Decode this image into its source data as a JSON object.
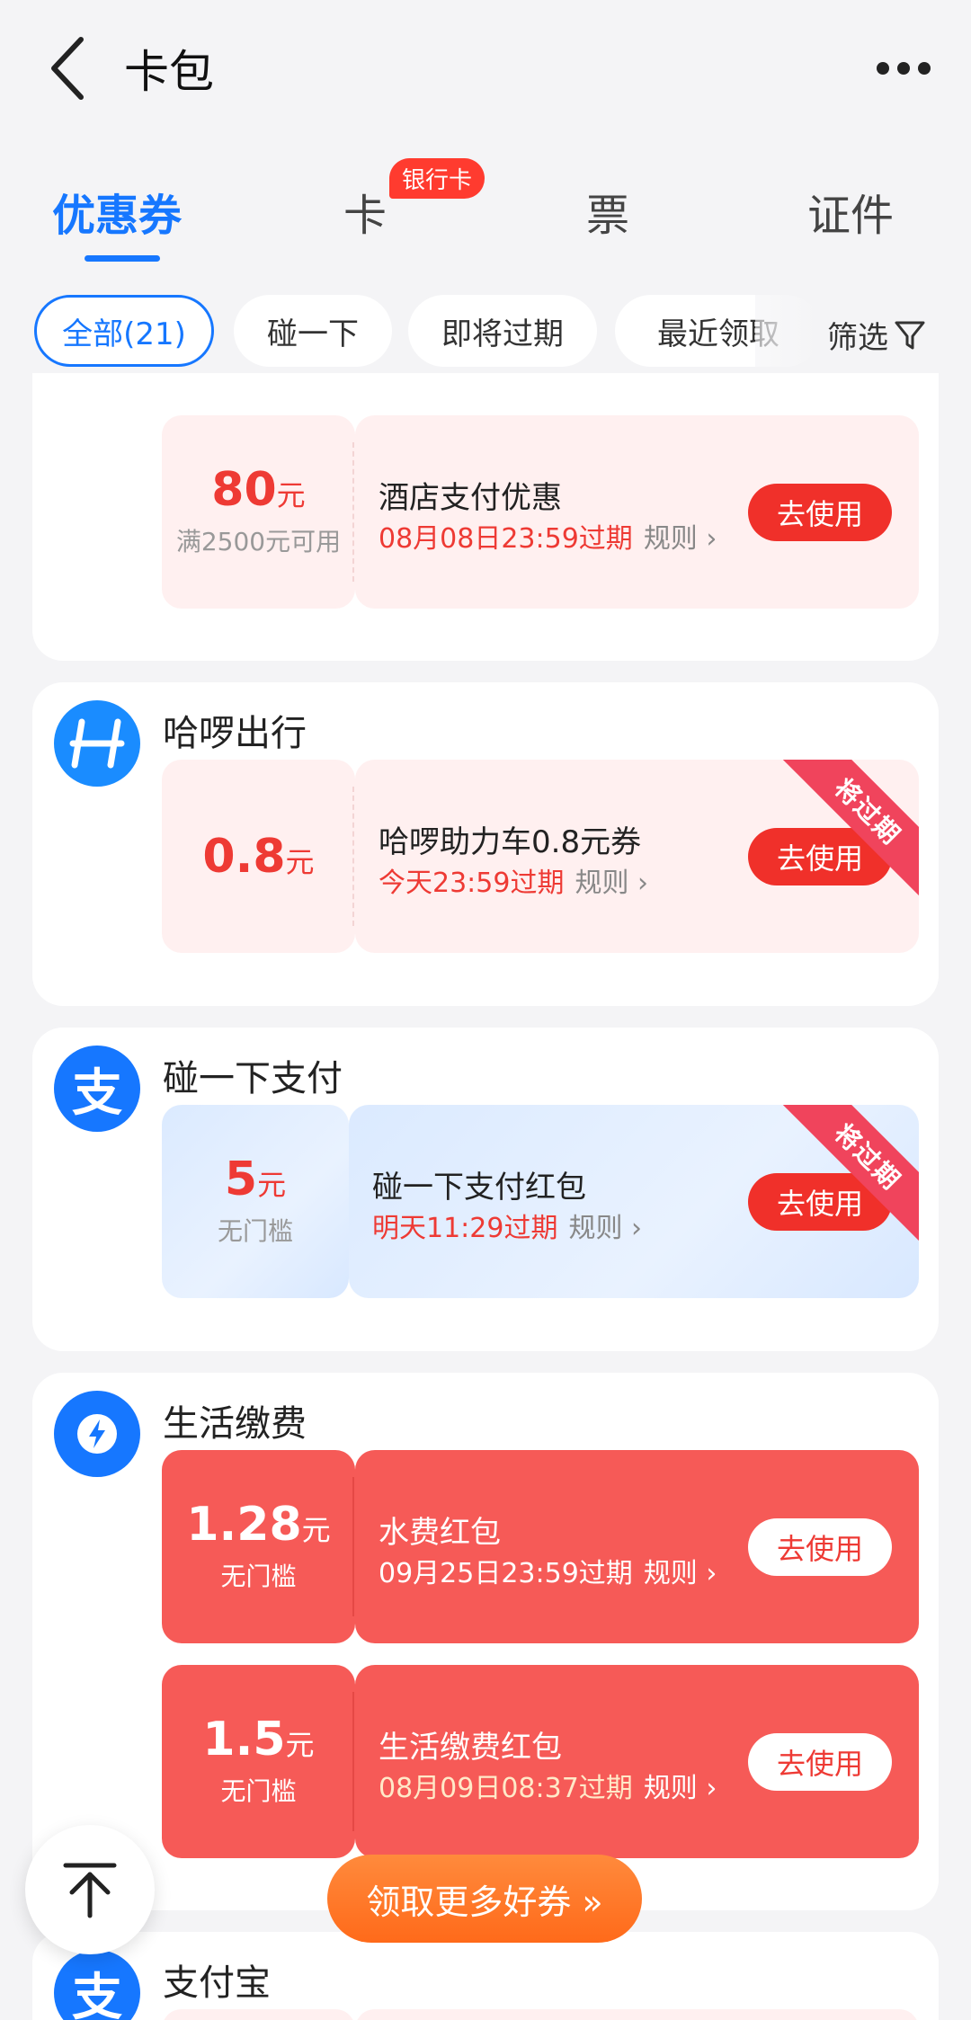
{
  "header": {
    "title": "卡包"
  },
  "tabs": [
    {
      "label": "优惠券"
    },
    {
      "label": "卡",
      "badge": "银行卡"
    },
    {
      "label": "票"
    },
    {
      "label": "证件"
    }
  ],
  "filters": {
    "chips": [
      "全部(21)",
      "碰一下",
      "即将过期",
      "最近领取"
    ],
    "filter_label": "筛选"
  },
  "cards": {
    "first": {
      "coupon": {
        "amount": "80",
        "unit": "元",
        "condition": "满2500元可用",
        "name": "酒店支付优惠",
        "expiry": "08月08日23:59过期",
        "rule": "规则",
        "button": "去使用"
      }
    },
    "hello": {
      "merchant": "哈啰出行",
      "coupon": {
        "amount": "0.8",
        "unit": "元",
        "name": "哈啰助力车0.8元券",
        "expiry": "今天23:59过期",
        "rule": "规则",
        "button": "去使用",
        "ribbon": "将过期"
      }
    },
    "nfc": {
      "merchant": "碰一下支付",
      "coupon": {
        "amount": "5",
        "unit": "元",
        "condition": "无门槛",
        "name": "碰一下支付红包",
        "expiry": "明天11:29过期",
        "rule": "规则",
        "button": "去使用",
        "ribbon": "将过期"
      }
    },
    "life": {
      "merchant": "生活缴费",
      "coupons": [
        {
          "amount": "1.28",
          "unit": "元",
          "condition": "无门槛",
          "name": "水费红包",
          "expiry": "09月25日23:59过期",
          "rule": "规则",
          "button": "去使用"
        },
        {
          "amount": "1.5",
          "unit": "元",
          "condition": "无门槛",
          "name": "生活缴费红包",
          "expiry": "08月09日08:37过期",
          "rule": "规则",
          "button": "去使用"
        }
      ]
    },
    "alipay": {
      "merchant": "支付宝"
    }
  },
  "floating": {
    "more_coupons": "领取更多好券 »"
  },
  "colors": {
    "accent": "#1677ff",
    "red": "#ee3a34",
    "coupon_red": "#f65a57",
    "orange": "#ff7a2a"
  }
}
